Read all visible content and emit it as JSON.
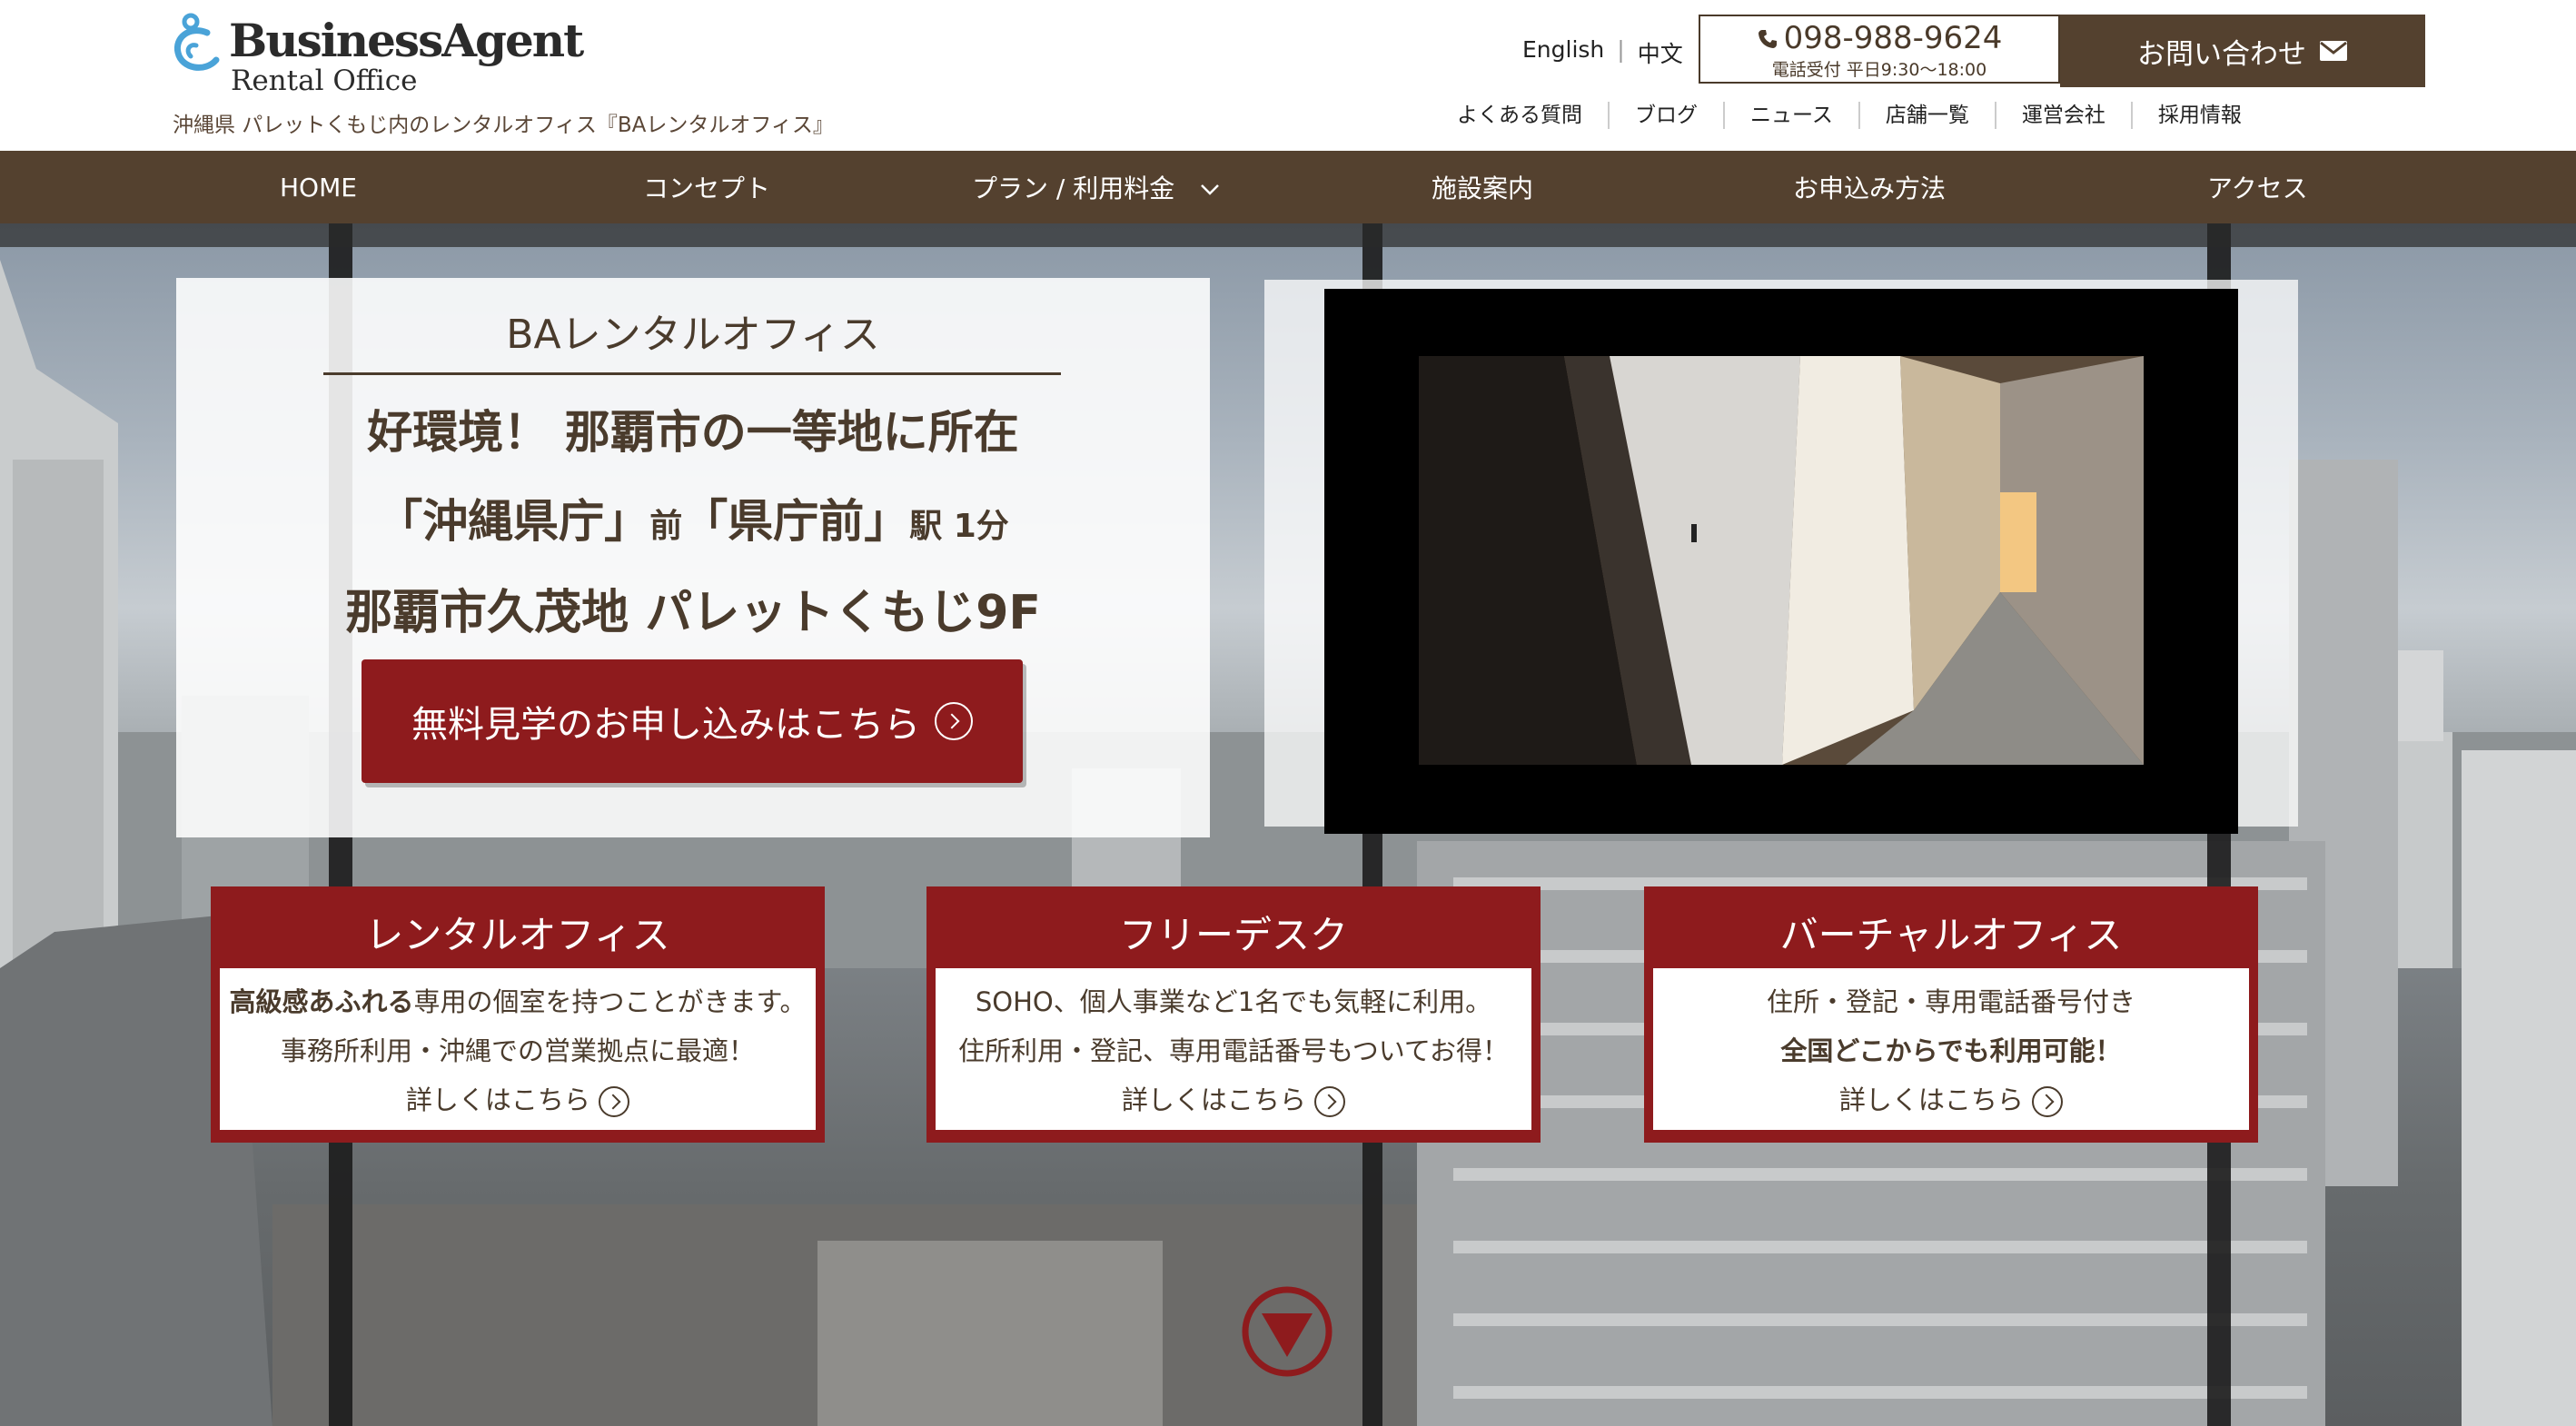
{
  "logo": {
    "main": "BusinessAgent",
    "sub": "Rental Office"
  },
  "tagline": "沖縄県 パレットくもじ内のレンタルオフィス『BAレンタルオフィス』",
  "language": {
    "english": "English",
    "separator": "|",
    "chinese": "中文"
  },
  "phone": {
    "number": "098-988-9624",
    "hours": "電話受付 平日9:30〜18:00",
    "icon": "phone-icon"
  },
  "contact": {
    "label": "お問い合わせ",
    "icon": "envelope-icon"
  },
  "utility_nav": [
    "よくある質問",
    "ブログ",
    "ニュース",
    "店舗一覧",
    "運営会社",
    "採用情報"
  ],
  "main_nav": {
    "home": "HOME",
    "concept": "コンセプト",
    "plans": "プラン / 利用料金",
    "facilities": "施設案内",
    "apply": "お申込み方法",
    "access": "アクセス"
  },
  "hero": {
    "title": "BAレンタルオフィス",
    "line1": "好環境！ 那覇市の一等地に所在",
    "line2": {
      "a": "「沖縄県庁」",
      "b": "前",
      "c": "「県庁前」",
      "d": "駅 1分"
    },
    "line3": "那覇市久茂地 パレットくもじ9F",
    "cta": "無料見学のお申し込みはこちら"
  },
  "cards": [
    {
      "title": "レンタルオフィス",
      "line1_bold": "高級感あふれる",
      "line1_rest": "専用の個室を持つことがきます。",
      "line2": "事務所利用・沖縄での営業拠点に最適！",
      "link": "詳しくはこちら"
    },
    {
      "title": "フリーデスク",
      "line1": "SOHO、個人事業など1名でも気軽に利用。",
      "line2": "住所利用・登記、専用電話番号もついてお得！",
      "link": "詳しくはこちら"
    },
    {
      "title": "バーチャルオフィス",
      "line1": "住所・登記・専用電話番号付き",
      "line2": "全国どこからでも利用可能！",
      "link": "詳しくはこちら"
    }
  ],
  "colors": {
    "brown": "#54412f",
    "red": "#8e1b1d",
    "text": "#4a3b2c"
  }
}
